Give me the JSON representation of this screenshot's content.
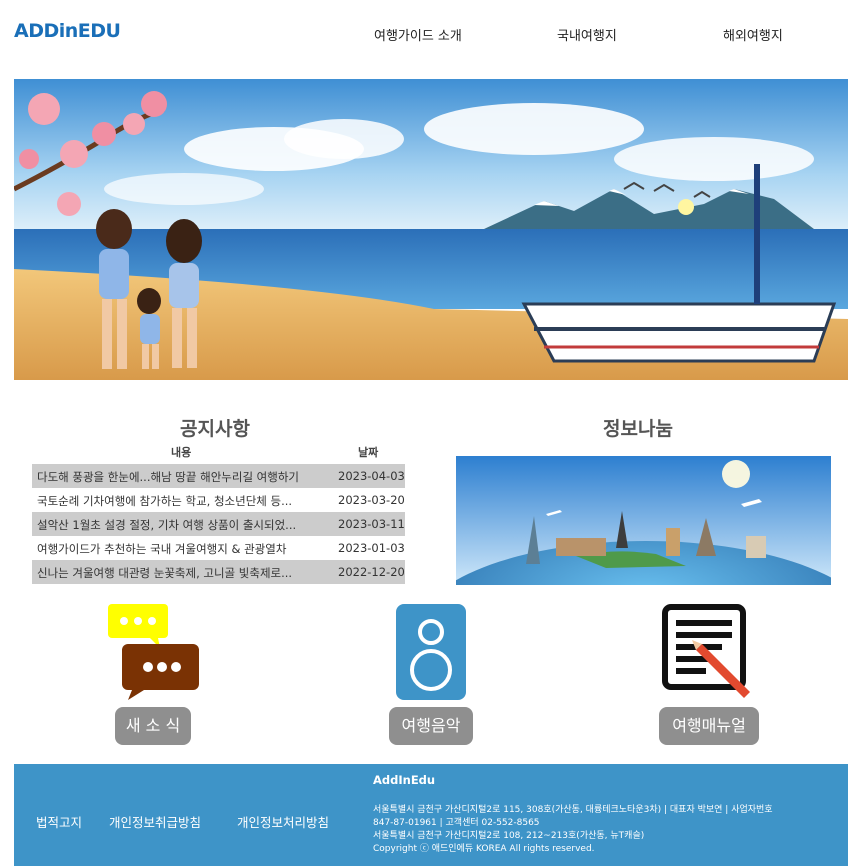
{
  "header": {
    "logo": "ADDinEDU",
    "nav": [
      "여행가이드 소개",
      "국내여행지",
      "해외여행지"
    ]
  },
  "notices": {
    "title": "공지사항",
    "columns": {
      "content": "내용",
      "date": "날짜"
    },
    "rows": [
      {
        "title": "다도해 풍광을 한눈에...해남 땅끝 해안누리길 여행하기",
        "date": "2023-04-03"
      },
      {
        "title": "국토순례 기차여행에 참가하는 학교, 청소년단체 등...",
        "date": "2023-03-20"
      },
      {
        "title": "설악산 1월초 설경 절정, 기차 여행 상품이 출시되었...",
        "date": "2023-03-11"
      },
      {
        "title": "여행가이드가 추천하는 국내 겨울여행지 & 관광열차",
        "date": "2023-01-03"
      },
      {
        "title": "신나는 겨울여행 대관령 눈꽃축제, 고니골 빛축제로...",
        "date": "2022-12-20"
      }
    ]
  },
  "info_share": {
    "title": "정보나눔"
  },
  "features": [
    {
      "label": "새 소 식",
      "icon": "speech-bubbles-icon"
    },
    {
      "label": "여행음악",
      "icon": "speaker-icon"
    },
    {
      "label": "여행매뉴얼",
      "icon": "document-pen-icon"
    }
  ],
  "footer": {
    "links": [
      "법적고지",
      "개인정보취급방침",
      "개인정보처리방침"
    ],
    "brand": "AddInEdu",
    "lines": [
      "서울특별시 금천구 가산디지털2로 115, 308호(가산동, 대륭테크노타운3차) | 대표자 박보연 | 사업자번호",
      "847-87-01961 | 고객센터 02-552-8565",
      "서울특별시 금천구 가산디지털2로 108, 212~213호(가산동, 뉴T캐슬)",
      "Copyright ⓒ 애드인에듀 KOREA All rights reserved."
    ]
  },
  "colors": {
    "accent": "#3e94c8",
    "logo": "#1a6fb8",
    "pill": "#8f8f8f",
    "row_shade": "#cccccc"
  }
}
